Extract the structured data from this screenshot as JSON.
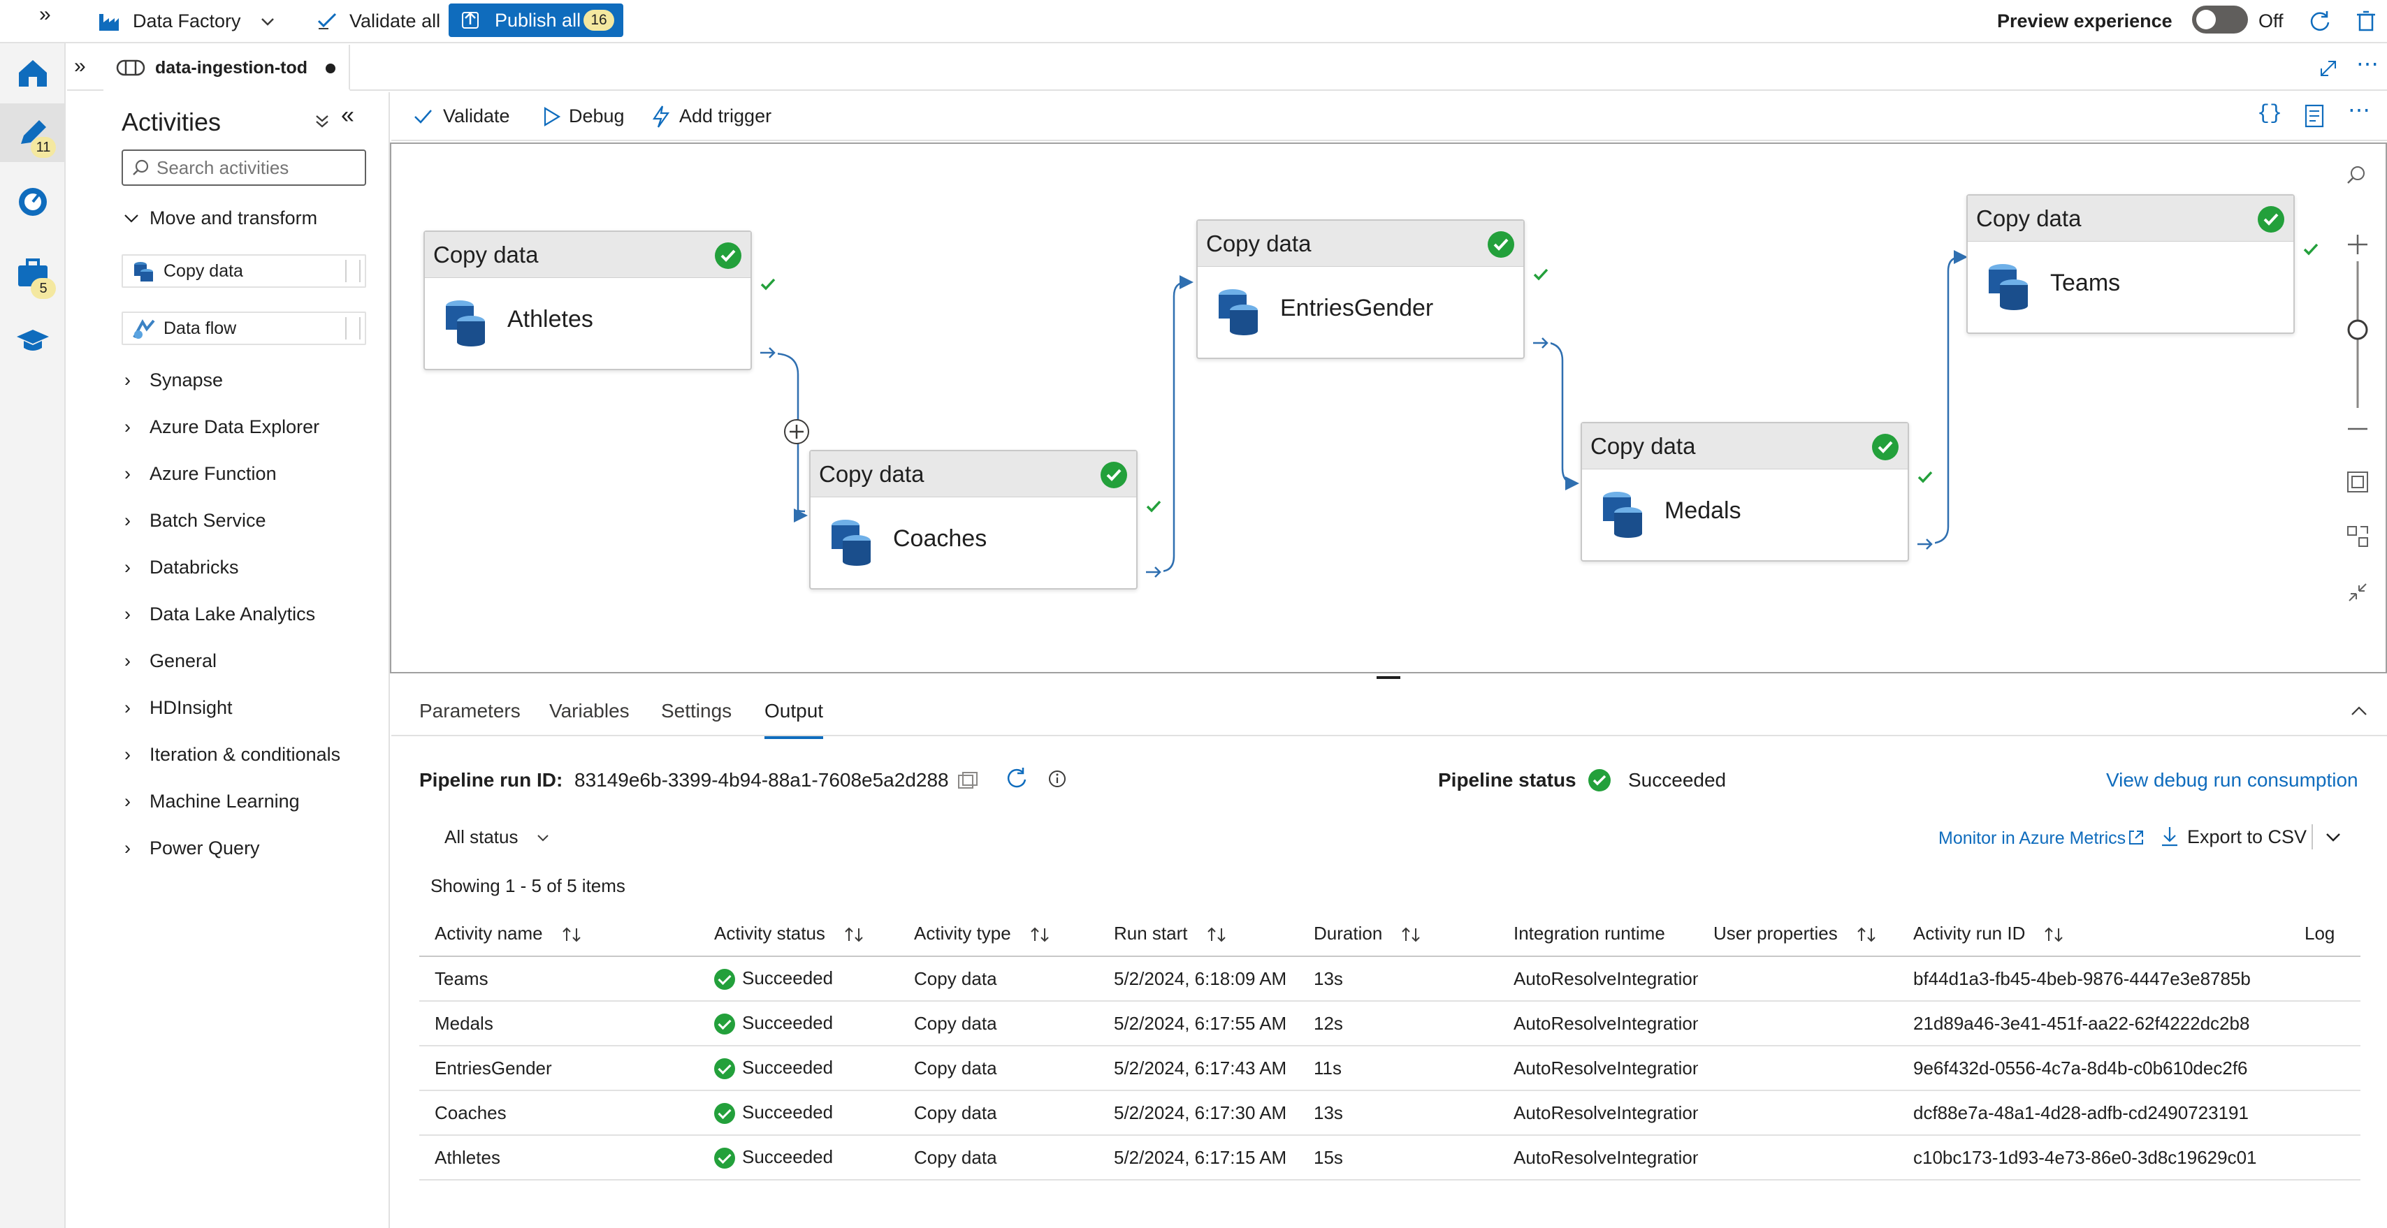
{
  "topbar": {
    "factory_label": "Data Factory",
    "validate_all": "Validate all",
    "publish_all": "Publish all",
    "publish_count": "16",
    "preview_label": "Preview experience",
    "toggle_state": "Off"
  },
  "rail": {
    "author_badge": "11",
    "manage_badge": "5"
  },
  "tab": {
    "name": "data-ingestion-tod"
  },
  "activities": {
    "title": "Activities",
    "search_placeholder": "Search activities",
    "open_group": "Move and transform",
    "items": [
      "Copy data",
      "Data flow"
    ],
    "categories": [
      "Synapse",
      "Azure Data Explorer",
      "Azure Function",
      "Batch Service",
      "Databricks",
      "Data Lake Analytics",
      "General",
      "HDInsight",
      "Iteration & conditionals",
      "Machine Learning",
      "Power Query"
    ]
  },
  "canvas_toolbar": {
    "validate": "Validate",
    "debug": "Debug",
    "add_trigger": "Add trigger"
  },
  "nodes": [
    {
      "type": "Copy data",
      "name": "Athletes"
    },
    {
      "type": "Copy data",
      "name": "Coaches"
    },
    {
      "type": "Copy data",
      "name": "EntriesGender"
    },
    {
      "type": "Copy data",
      "name": "Medals"
    },
    {
      "type": "Copy data",
      "name": "Teams"
    }
  ],
  "bottom_tabs": [
    "Parameters",
    "Variables",
    "Settings",
    "Output"
  ],
  "output": {
    "run_id_label": "Pipeline run ID:",
    "run_id": "83149e6b-3399-4b94-88a1-7608e5a2d288",
    "pipeline_status_label": "Pipeline status",
    "pipeline_status": "Succeeded",
    "debug_link": "View debug run consumption",
    "filter": "All status",
    "monitor_link": "Monitor in Azure Metrics",
    "export": "Export to CSV",
    "showing": "Showing 1 - 5 of 5 items",
    "columns": [
      "Activity name",
      "Activity status",
      "Activity type",
      "Run start",
      "Duration",
      "Integration runtime",
      "User properties",
      "Activity run ID",
      "Log"
    ],
    "rows": [
      {
        "name": "Teams",
        "status": "Succeeded",
        "type": "Copy data",
        "start": "5/2/2024, 6:18:09 AM",
        "duration": "13s",
        "runtime": "AutoResolveIntegration",
        "props": "",
        "run_id": "bf44d1a3-fb45-4beb-9876-4447e3e8785b"
      },
      {
        "name": "Medals",
        "status": "Succeeded",
        "type": "Copy data",
        "start": "5/2/2024, 6:17:55 AM",
        "duration": "12s",
        "runtime": "AutoResolveIntegration",
        "props": "",
        "run_id": "21d89a46-3e41-451f-aa22-62f4222dc2b8"
      },
      {
        "name": "EntriesGender",
        "status": "Succeeded",
        "type": "Copy data",
        "start": "5/2/2024, 6:17:43 AM",
        "duration": "11s",
        "runtime": "AutoResolveIntegration",
        "props": "",
        "run_id": "9e6f432d-0556-4c7a-8d4b-c0b610dec2f6"
      },
      {
        "name": "Coaches",
        "status": "Succeeded",
        "type": "Copy data",
        "start": "5/2/2024, 6:17:30 AM",
        "duration": "13s",
        "runtime": "AutoResolveIntegration",
        "props": "",
        "run_id": "dcf88e7a-48a1-4d28-adfb-cd2490723191"
      },
      {
        "name": "Athletes",
        "status": "Succeeded",
        "type": "Copy data",
        "start": "5/2/2024, 6:17:15 AM",
        "duration": "15s",
        "runtime": "AutoResolveIntegration",
        "props": "",
        "run_id": "c10bc173-1d93-4e73-86e0-3d8c19629c01"
      }
    ]
  },
  "colors": {
    "accent": "#0f6cbd",
    "success": "#23a03b",
    "badge": "#f4e8a0"
  }
}
